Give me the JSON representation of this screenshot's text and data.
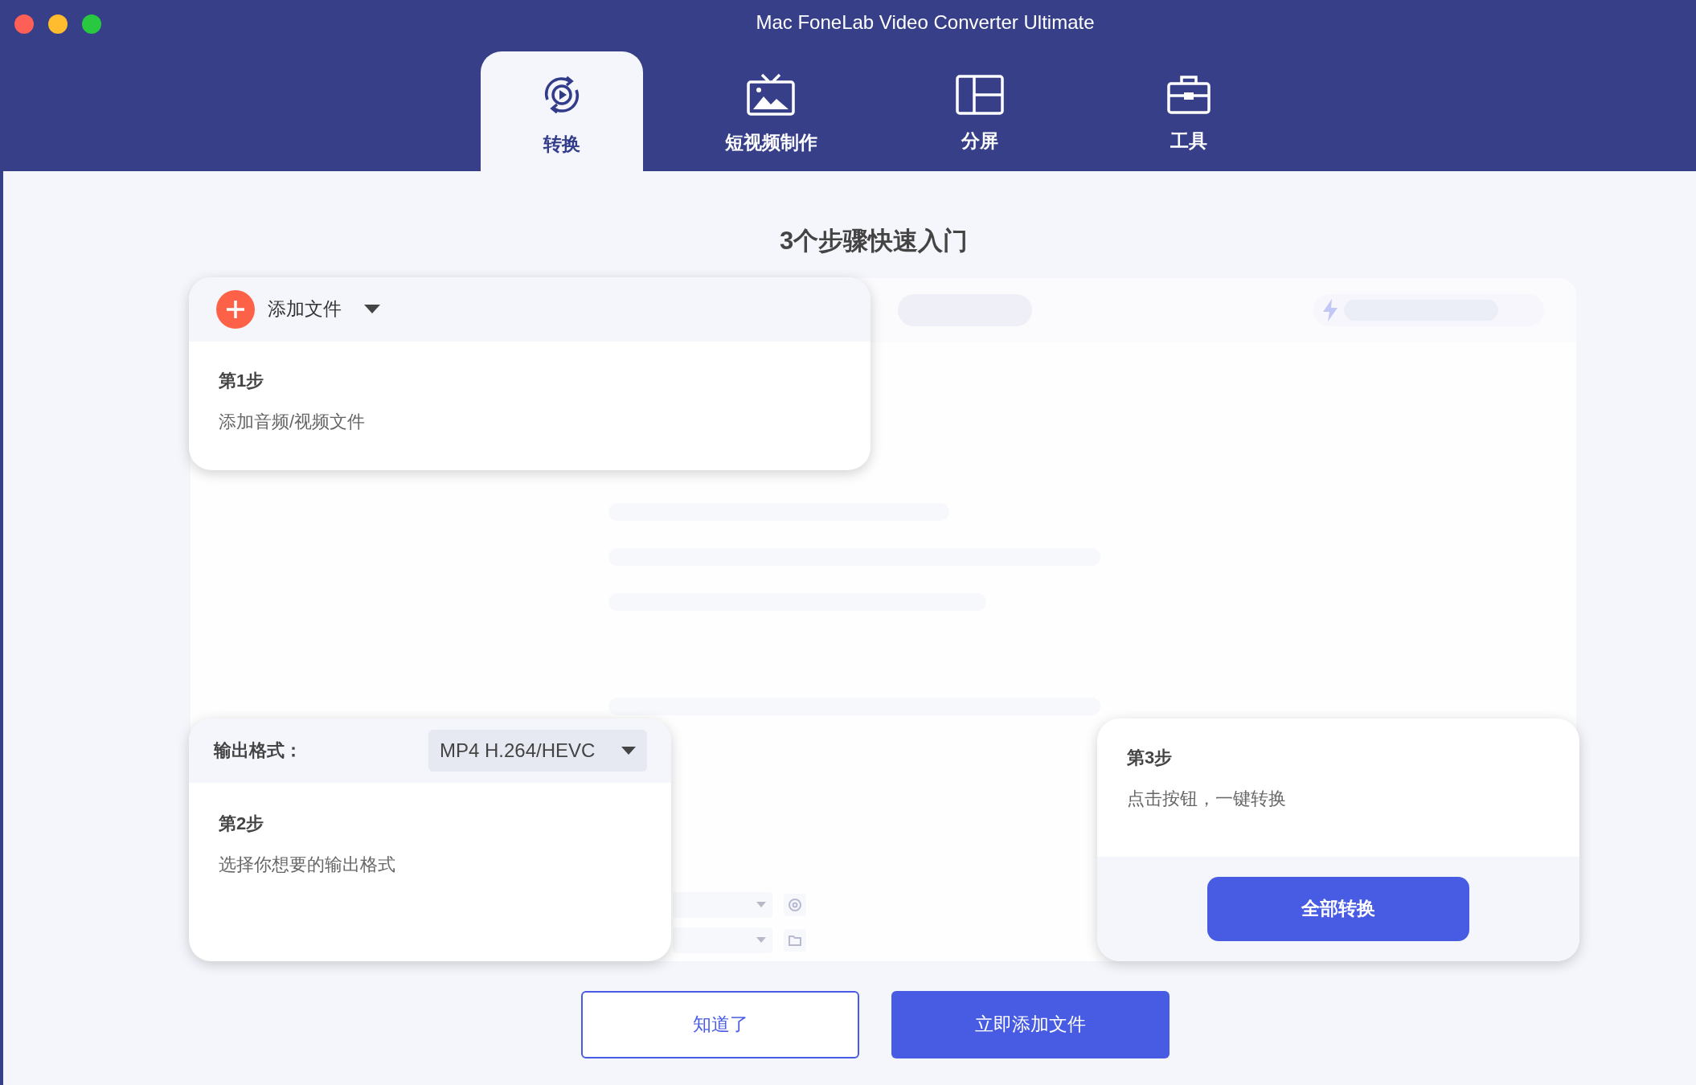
{
  "window": {
    "title": "Mac FoneLab Video Converter Ultimate"
  },
  "tabs": [
    {
      "kind": "convert",
      "label": "转换",
      "selected": true
    },
    {
      "kind": "mv",
      "label": "短视频制作",
      "selected": false
    },
    {
      "kind": "collage",
      "label": "分屏",
      "selected": false
    },
    {
      "kind": "toolbox",
      "label": "工具",
      "selected": false
    }
  ],
  "heading": "3个步骤快速入门",
  "step_1": {
    "add_button": "添加文件",
    "title": "第1步",
    "description": "添加音频/视频文件"
  },
  "step_2": {
    "label": "输出格式：",
    "format": "MP4 H.264/HEVC",
    "title": "第2步",
    "description": "选择你想要的输出格式"
  },
  "step_3": {
    "title": "第3步",
    "description": "点击按钮，一键转换",
    "convert_button": "全部转换"
  },
  "buttons": [
    {
      "kind": "outline",
      "label": "知道了"
    },
    {
      "kind": "primary",
      "label": "立即添加文件"
    }
  ]
}
